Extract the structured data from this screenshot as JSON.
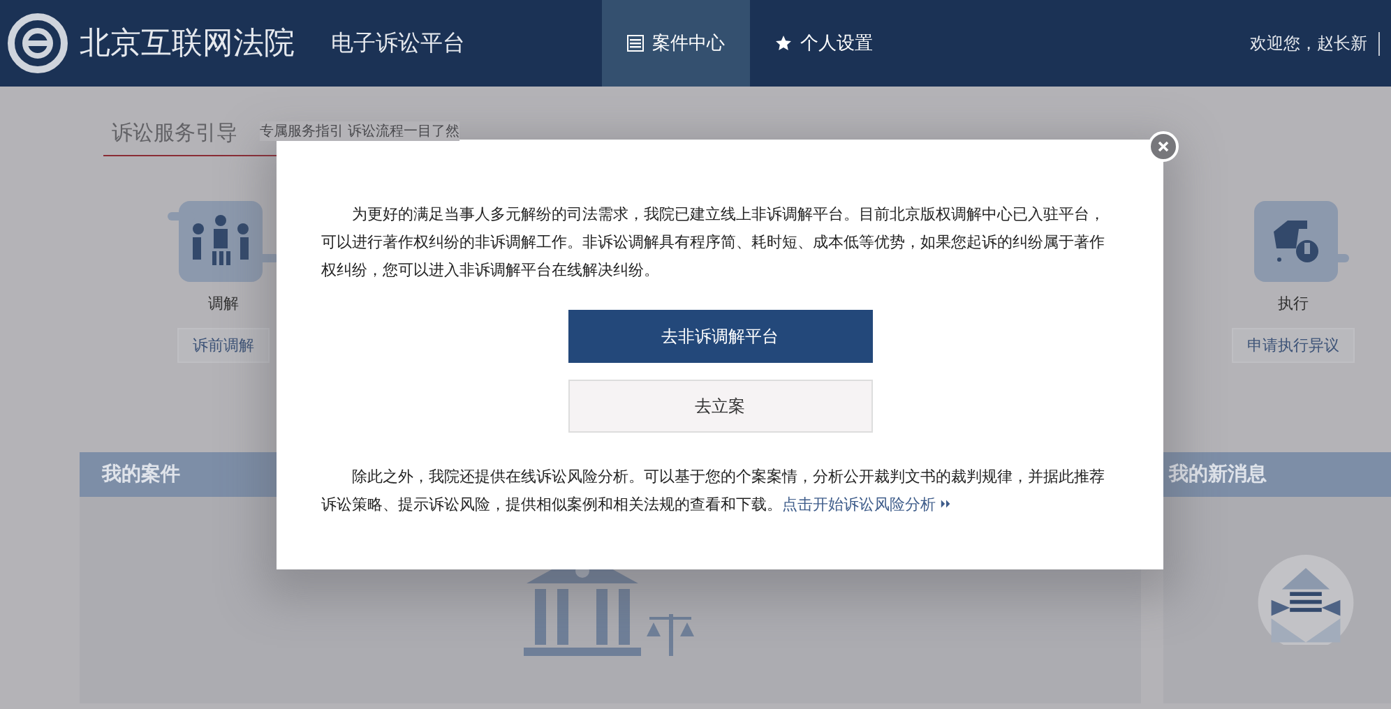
{
  "header": {
    "title": "北京互联网法院",
    "subtitle": "电子诉讼平台",
    "nav": [
      {
        "label": "案件中心",
        "kind": "list",
        "selected": true
      },
      {
        "label": "个人设置",
        "kind": "star",
        "selected": false
      }
    ],
    "welcome": "欢迎您，赵长新"
  },
  "guide": {
    "title": "诉讼服务引导",
    "subtitle": "专属服务指引 诉讼流程一目了然",
    "steps": [
      {
        "kind": "people",
        "label": "调解",
        "button": "诉前调解"
      },
      {
        "kind": "hand",
        "label": "执行",
        "button": "申请执行异议"
      }
    ]
  },
  "panels": [
    {
      "kind": "cases",
      "title": "我的案件"
    },
    {
      "kind": "messages",
      "title": "我的新消息"
    }
  ],
  "modal": {
    "paragraph": "为更好的满足当事人多元解纷的司法需求，我院已建立线上非诉调解平台。目前北京版权调解中心已入驻平台，可以进行著作权纠纷的非诉调解工作。非诉讼调解具有程序简、耗时短、成本低等优势，如果您起诉的纠纷属于著作权纠纷，您可以进入非诉调解平台在线解决纠纷。",
    "primary_button": "去非诉调解平台",
    "secondary_button": "去立案",
    "risk_text": "除此之外，我院还提供在线诉讼风险分析。可以基于您的个案案情，分析公开裁判文书的裁判规律，并据此推荐诉讼策略、提示诉讼风险，提供相似案例和相关法规的查看和下载。",
    "risk_link": "点击开始诉讼风险分析"
  }
}
